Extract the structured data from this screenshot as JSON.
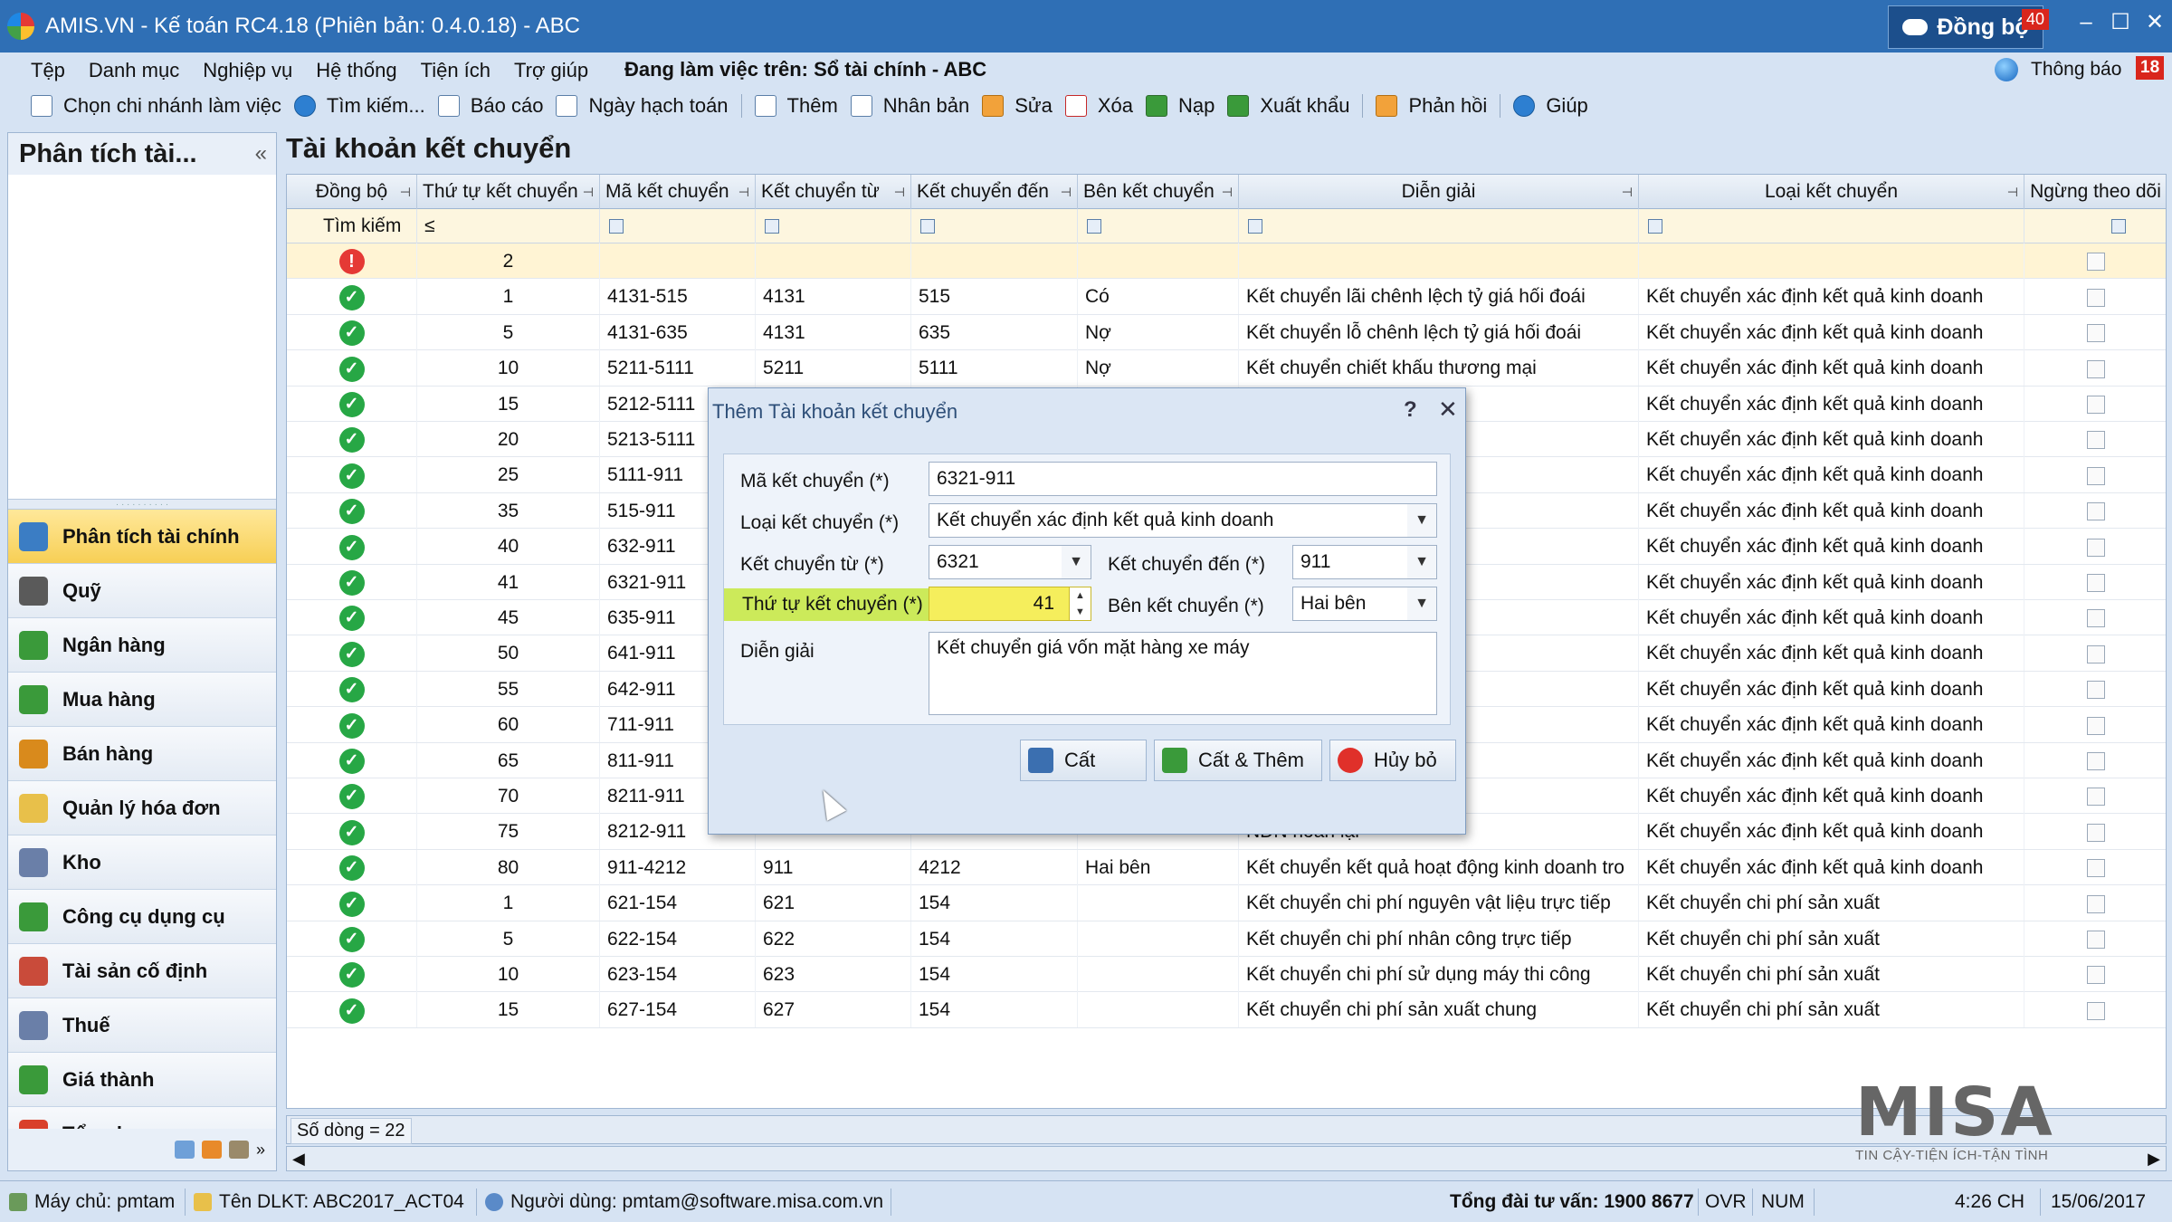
{
  "window": {
    "title": "AMIS.VN - Kế toán RC4.18 (Phiên bản: 0.4.0.18) - ABC",
    "sync_label": "Đồng bộ",
    "sync_count": "40",
    "minimize": "–",
    "maximize": "☐",
    "close": "✕"
  },
  "menu": [
    "Tệp",
    "Danh mục",
    "Nghiệp vụ",
    "Hệ thống",
    "Tiện ích",
    "Trợ giúp"
  ],
  "working_on": "Đang làm việc trên: Sổ tài chính - ABC",
  "notifications": {
    "label": "Thông báo",
    "count": "18"
  },
  "toolbar": [
    {
      "label": "Chọn chi nhánh làm việc",
      "icon": "branch-icon"
    },
    {
      "label": "Tìm kiếm...",
      "icon": "search-icon"
    },
    {
      "label": "Báo cáo",
      "icon": "report-icon"
    },
    {
      "label": "Ngày hạch toán",
      "icon": "calendar-icon"
    },
    {
      "label": "Thêm",
      "icon": "add-icon"
    },
    {
      "label": "Nhân bản",
      "icon": "duplicate-icon"
    },
    {
      "label": "Sửa",
      "icon": "edit-icon"
    },
    {
      "label": "Xóa",
      "icon": "delete-icon"
    },
    {
      "label": "Nạp",
      "icon": "reload-icon"
    },
    {
      "label": "Xuất khẩu",
      "icon": "export-icon"
    },
    {
      "label": "Phản hồi",
      "icon": "feedback-icon"
    },
    {
      "label": "Giúp",
      "icon": "help-icon"
    }
  ],
  "left_panel": {
    "title": "Phân tích tài...",
    "collapse": "«",
    "nav": [
      {
        "label": "Phân tích tài chính",
        "icon": "monitor-chart-icon",
        "active": true,
        "color": "#3b7dc4"
      },
      {
        "label": "Quỹ",
        "icon": "cash-box-icon",
        "active": false,
        "color": "#5a5a5a"
      },
      {
        "label": "Ngân hàng",
        "icon": "bank-icon",
        "active": false,
        "color": "#3a9a3a"
      },
      {
        "label": "Mua hàng",
        "icon": "purchase-icon",
        "active": false,
        "color": "#3a9a3a"
      },
      {
        "label": "Bán hàng",
        "icon": "store-icon",
        "active": false,
        "color": "#d98a1c"
      },
      {
        "label": "Quản lý hóa đơn",
        "icon": "invoice-folder-icon",
        "active": false,
        "color": "#e8c04a"
      },
      {
        "label": "Kho",
        "icon": "warehouse-icon",
        "active": false,
        "color": "#6a7fa8"
      },
      {
        "label": "Công cụ dụng cụ",
        "icon": "tools-icon",
        "active": false,
        "color": "#3a9a3a"
      },
      {
        "label": "Tài sản cố định",
        "icon": "house-icon",
        "active": false,
        "color": "#c94b3a"
      },
      {
        "label": "Thuế",
        "icon": "tax-doc-icon",
        "active": false,
        "color": "#6a7fa8"
      },
      {
        "label": "Giá thành",
        "icon": "price-icon",
        "active": false,
        "color": "#3a9a3a"
      },
      {
        "label": "Tổng hợp",
        "icon": "summary-icon",
        "active": false,
        "color": "#d9402a"
      }
    ]
  },
  "main": {
    "title": "Tài khoản kết chuyển",
    "columns": [
      {
        "key": "sync",
        "label": "Đồng bộ",
        "pin": true
      },
      {
        "key": "order",
        "label": "Thứ tự kết chuyển",
        "pin": true
      },
      {
        "key": "code",
        "label": "Mã kết chuyển",
        "pin": true
      },
      {
        "key": "from",
        "label": "Kết chuyển từ",
        "pin": true
      },
      {
        "key": "to",
        "label": "Kết chuyển đến",
        "pin": true
      },
      {
        "key": "side",
        "label": "Bên kết chuyển",
        "pin": true
      },
      {
        "key": "desc",
        "label": "Diễn giải",
        "pin": true
      },
      {
        "key": "type",
        "label": "Loại kết chuyển",
        "pin": true
      },
      {
        "key": "stop",
        "label": "Ngừng theo dõi",
        "pin": false
      }
    ],
    "filter": {
      "search_label": "Tìm kiếm",
      "operator": "≤"
    },
    "new_row": {
      "status": "error",
      "order": "2"
    },
    "rows": [
      {
        "order": "1",
        "code": "4131-515",
        "from": "4131",
        "to": "515",
        "side": "Có",
        "desc": "Kết chuyển lãi chênh lệch tỷ giá hối đoái",
        "type": "Kết chuyển xác định kết quả kinh doanh"
      },
      {
        "order": "5",
        "code": "4131-635",
        "from": "4131",
        "to": "635",
        "side": "Nợ",
        "desc": "Kết chuyển lỗ chênh lệch tỷ giá hối đoái",
        "type": "Kết chuyển xác định kết quả kinh doanh"
      },
      {
        "order": "10",
        "code": "5211-5111",
        "from": "5211",
        "to": "5111",
        "side": "Nợ",
        "desc": "Kết chuyển chiết khấu thương mại",
        "type": "Kết chuyển xác định kết quả kinh doanh"
      },
      {
        "order": "15",
        "code": "5212-5111",
        "from": "",
        "to": "",
        "side": "",
        "desc": "lại",
        "type": "Kết chuyển xác định kết quả kinh doanh"
      },
      {
        "order": "20",
        "code": "5213-5111",
        "from": "",
        "to": "",
        "side": "",
        "desc": "bán",
        "type": "Kết chuyển xác định kết quả kinh doanh"
      },
      {
        "order": "25",
        "code": "5111-911",
        "from": "",
        "to": "",
        "side": "",
        "desc": "xe máy",
        "type": "Kết chuyển xác định kết quả kinh doanh"
      },
      {
        "order": "35",
        "code": "515-911",
        "from": "",
        "to": "",
        "side": "",
        "desc": "động tài chính",
        "type": "Kết chuyển xác định kết quả kinh doanh"
      },
      {
        "order": "40",
        "code": "632-911",
        "from": "",
        "to": "",
        "side": "",
        "desc": "án",
        "type": "Kết chuyển xác định kết quả kinh doanh"
      },
      {
        "order": "41",
        "code": "6321-911",
        "from": "",
        "to": "",
        "side": "",
        "desc": "ng xe máy",
        "type": "Kết chuyển xác định kết quả kinh doanh"
      },
      {
        "order": "45",
        "code": "635-911",
        "from": "",
        "to": "",
        "side": "",
        "desc": "ng tài chính",
        "type": "Kết chuyển xác định kết quả kinh doanh"
      },
      {
        "order": "50",
        "code": "641-911",
        "from": "",
        "to": "",
        "side": "",
        "desc": "ng",
        "type": "Kết chuyển xác định kết quả kinh doanh"
      },
      {
        "order": "55",
        "code": "642-911",
        "from": "",
        "to": "",
        "side": "",
        "desc": "doanh nghiệp",
        "type": "Kết chuyển xác định kết quả kinh doanh"
      },
      {
        "order": "60",
        "code": "711-911",
        "from": "",
        "to": "",
        "side": "",
        "desc": "phát sinh trong kỳ",
        "type": "Kết chuyển xác định kết quả kinh doanh"
      },
      {
        "order": "65",
        "code": "811-911",
        "from": "",
        "to": "",
        "side": "",
        "desc": "hát sinh trong kỳ",
        "type": "Kết chuyển xác định kết quả kinh doanh"
      },
      {
        "order": "70",
        "code": "8211-911",
        "from": "",
        "to": "",
        "side": "",
        "desc": "NDN",
        "type": "Kết chuyển xác định kết quả kinh doanh"
      },
      {
        "order": "75",
        "code": "8212-911",
        "from": "",
        "to": "",
        "side": "",
        "desc": "NDN hoãn lại",
        "type": "Kết chuyển xác định kết quả kinh doanh"
      },
      {
        "order": "80",
        "code": "911-4212",
        "from": "911",
        "to": "4212",
        "side": "Hai bên",
        "desc": "Kết chuyển kết quả hoạt động kinh doanh tro",
        "type": "Kết chuyển xác định kết quả kinh doanh"
      },
      {
        "order": "1",
        "code": "621-154",
        "from": "621",
        "to": "154",
        "side": "",
        "desc": "Kết chuyển chi phí nguyên vật liệu trực tiếp",
        "type": "Kết chuyển chi phí sản xuất"
      },
      {
        "order": "5",
        "code": "622-154",
        "from": "622",
        "to": "154",
        "side": "",
        "desc": "Kết chuyển chi phí nhân công trực tiếp",
        "type": "Kết chuyển chi phí sản xuất"
      },
      {
        "order": "10",
        "code": "623-154",
        "from": "623",
        "to": "154",
        "side": "",
        "desc": "Kết chuyển chi phí sử dụng máy thi công",
        "type": "Kết chuyển chi phí sản xuất"
      },
      {
        "order": "15",
        "code": "627-154",
        "from": "627",
        "to": "154",
        "side": "",
        "desc": "Kết chuyển chi phí sản xuất chung",
        "type": "Kết chuyển chi phí sản xuất"
      }
    ],
    "row_count": "Số dòng = 22"
  },
  "dialog": {
    "title": "Thêm Tài khoản kết chuyển",
    "help": "?",
    "close": "✕",
    "code_label": "Mã kết chuyển (*)",
    "code_value": "6321-911",
    "type_label": "Loại kết chuyển (*)",
    "type_value": "Kết chuyển xác định kết quả kinh doanh",
    "from_label": "Kết chuyển từ (*)",
    "from_value": "6321",
    "to_label": "Kết chuyển đến (*)",
    "to_value": "911",
    "order_label": "Thứ tự kết chuyển (*)",
    "order_value": "41",
    "side_label": "Bên kết chuyển (*)",
    "side_value": "Hai bên",
    "desc_label": "Diễn giải",
    "desc_value": "Kết chuyển giá vốn mặt hàng xe máy",
    "save": "Cất",
    "save_add": "Cất & Thêm",
    "cancel": "Hủy bỏ"
  },
  "brand": {
    "name": "MISA",
    "tagline": "TIN CẬY-TIỆN ÍCH-TẬN TÌNH"
  },
  "status": {
    "server": "Máy chủ: pmtam",
    "db": "Tên DLKT: ABC2017_ACT04",
    "user": "Người dùng: pmtam@software.misa.com.vn",
    "hotline": "Tổng đài tư vấn: 1900 8677",
    "ovr": "OVR",
    "num": "NUM",
    "time": "4:26 CH",
    "date": "15/06/2017"
  }
}
